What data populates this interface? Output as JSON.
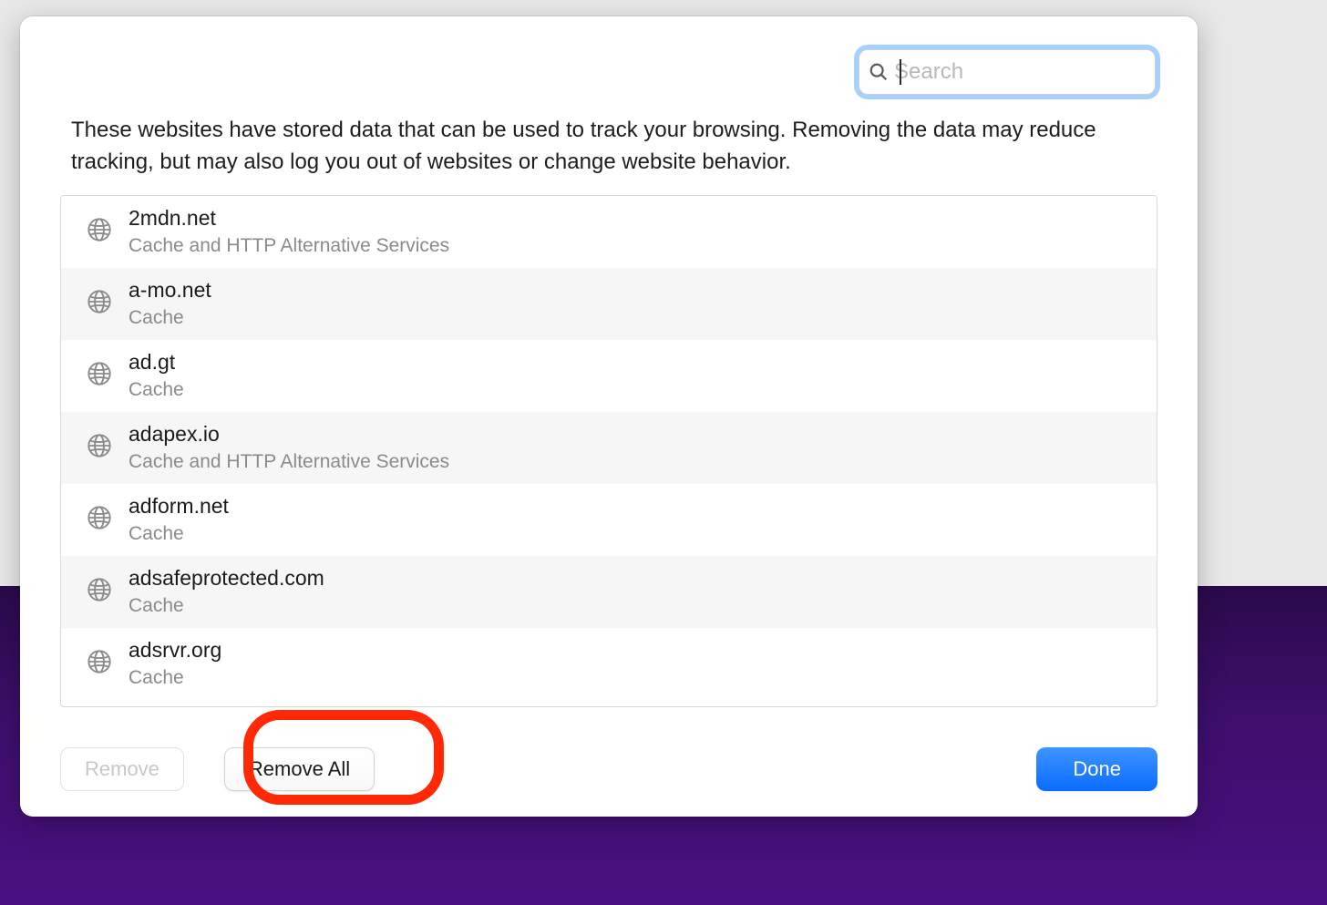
{
  "search": {
    "placeholder": "Search"
  },
  "description": "These websites have stored data that can be used to track your browsing. Removing the data may reduce tracking, but may also log you out of websites or change website behavior.",
  "websites": [
    {
      "domain": "2mdn.net",
      "detail": "Cache and HTTP Alternative Services"
    },
    {
      "domain": "a-mo.net",
      "detail": "Cache"
    },
    {
      "domain": "ad.gt",
      "detail": "Cache"
    },
    {
      "domain": "adapex.io",
      "detail": "Cache and HTTP Alternative Services"
    },
    {
      "domain": "adform.net",
      "detail": "Cache"
    },
    {
      "domain": "adsafeprotected.com",
      "detail": "Cache"
    },
    {
      "domain": "adsrvr.org",
      "detail": "Cache"
    }
  ],
  "buttons": {
    "remove": "Remove",
    "remove_all": "Remove All",
    "done": "Done"
  }
}
